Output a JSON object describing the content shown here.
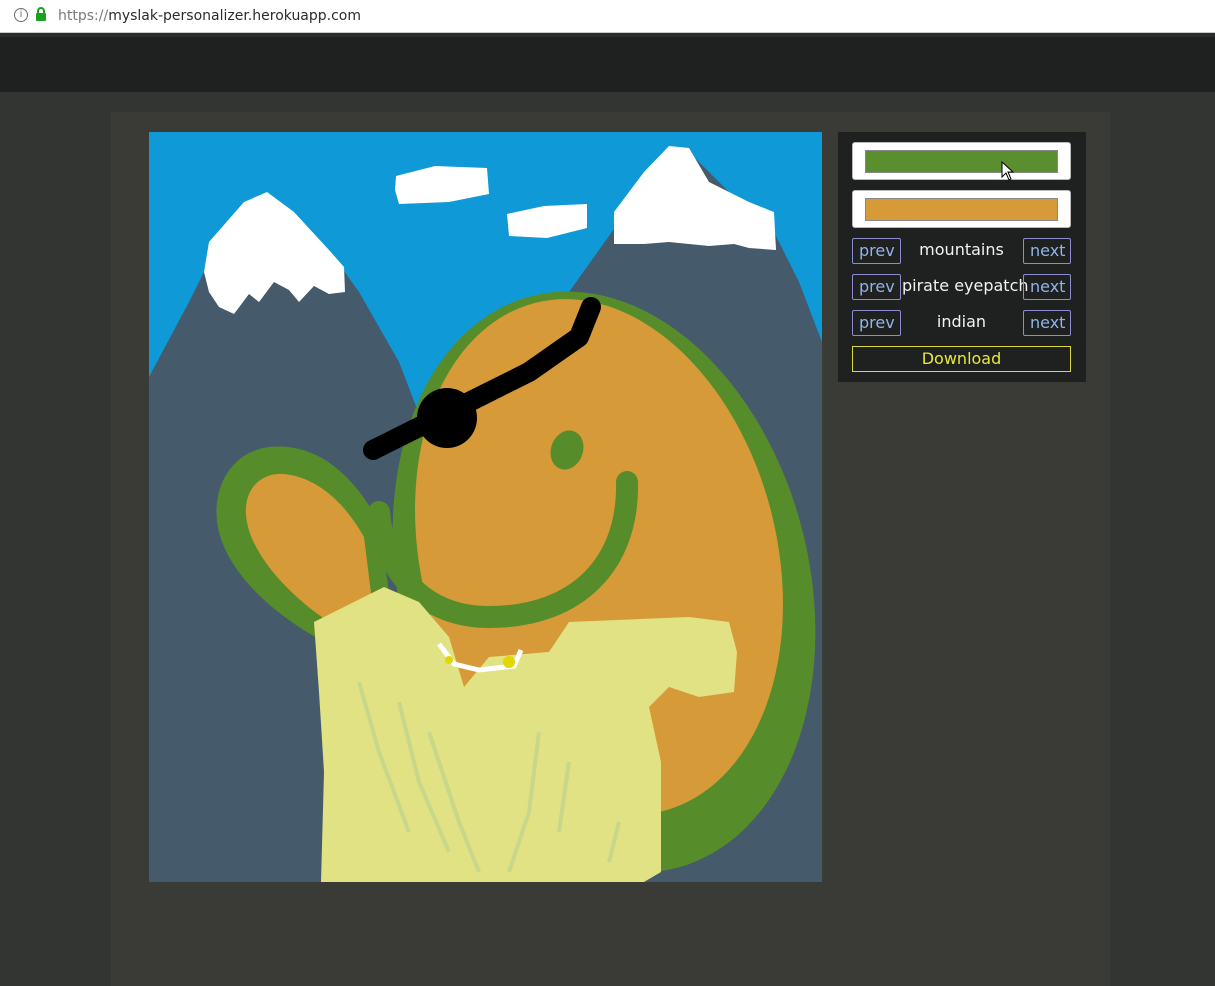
{
  "browser": {
    "url_scheme": "https://",
    "url_host": "myslak-personalizer.herokuapp.com",
    "info_icon": "i"
  },
  "colors": {
    "primary": "#5a8f2f",
    "secondary": "#d69a38",
    "sky": "#0f99d6",
    "mountain": "#455a6a",
    "skin": "#d69a38",
    "outline": "#578c2b",
    "shirt": "#e0e284",
    "accent_download": "#e8e83a"
  },
  "controls": {
    "color_swatch_1": "#5a8f2f",
    "color_swatch_2": "#d69a38",
    "rows": [
      {
        "prev": "prev",
        "label": "mountains",
        "next": "next"
      },
      {
        "prev": "prev",
        "label": "pirate eyepatch",
        "next": "next"
      },
      {
        "prev": "prev",
        "label": "indian",
        "next": "next"
      }
    ],
    "download_label": "Download"
  }
}
